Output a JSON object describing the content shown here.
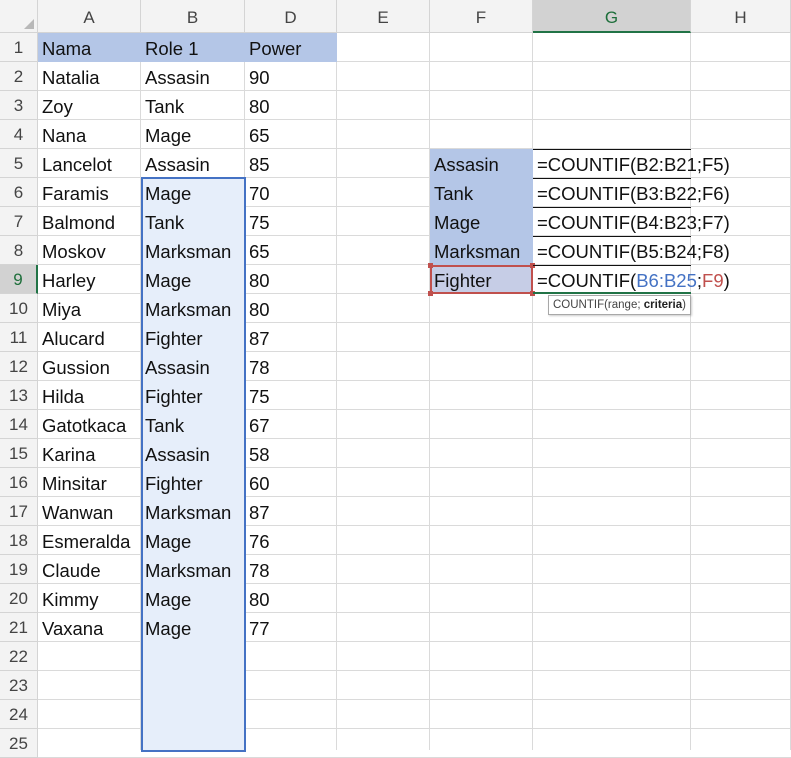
{
  "columns": [
    "A",
    "B",
    "D",
    "E",
    "F",
    "G",
    "H"
  ],
  "active_column": "G",
  "active_row": 9,
  "rows": [
    1,
    2,
    3,
    4,
    5,
    6,
    7,
    8,
    9,
    10,
    11,
    12,
    13,
    14,
    15,
    16,
    17,
    18,
    19,
    20,
    21,
    22,
    23,
    24,
    25
  ],
  "header_row": {
    "A": "Nama",
    "B": "Role 1",
    "D": "Power"
  },
  "table": [
    {
      "name": "Natalia",
      "role": "Assasin",
      "power": "90"
    },
    {
      "name": "Zoy",
      "role": "Tank",
      "power": "80"
    },
    {
      "name": "Nana",
      "role": "Mage",
      "power": "65"
    },
    {
      "name": "Lancelot",
      "role": "Assasin",
      "power": "85"
    },
    {
      "name": "Faramis",
      "role": "Mage",
      "power": "70"
    },
    {
      "name": "Balmond",
      "role": "Tank",
      "power": "75"
    },
    {
      "name": "Moskov",
      "role": "Marksman",
      "power": "65"
    },
    {
      "name": "Harley",
      "role": "Mage",
      "power": "80"
    },
    {
      "name": "Miya",
      "role": "Marksman",
      "power": "80"
    },
    {
      "name": "Alucard",
      "role": "Fighter",
      "power": "87"
    },
    {
      "name": "Gussion",
      "role": "Assasin",
      "power": "78"
    },
    {
      "name": "Hilda",
      "role": "Fighter",
      "power": "75"
    },
    {
      "name": "Gatotkaca",
      "role": "Tank",
      "power": "67"
    },
    {
      "name": "Karina",
      "role": "Assasin",
      "power": "58"
    },
    {
      "name": "Minsitar",
      "role": "Fighter",
      "power": "60"
    },
    {
      "name": "Wanwan",
      "role": "Marksman",
      "power": "87"
    },
    {
      "name": "Esmeralda",
      "role": "Mage",
      "power": "76"
    },
    {
      "name": "Claude",
      "role": "Marksman",
      "power": "78"
    },
    {
      "name": "Kimmy",
      "role": "Mage",
      "power": "80"
    },
    {
      "name": "Vaxana",
      "role": "Mage",
      "power": "77"
    }
  ],
  "summary": [
    {
      "role": "Assasin",
      "formula": "=COUNTIF(B2:B21;F5)"
    },
    {
      "role": "Tank",
      "formula": "=COUNTIF(B3:B22;F6)"
    },
    {
      "role": "Mage",
      "formula": "=COUNTIF(B4:B23;F7)"
    },
    {
      "role": "Marksman",
      "formula": "=COUNTIF(B5:B24;F8)"
    }
  ],
  "editing": {
    "role": "Fighter",
    "prefix": "=COUNTIF(",
    "range_ref": "B6:B25",
    "sep": ";",
    "crit_ref": "F9",
    "suffix": ")"
  },
  "tooltip": {
    "fn": "COUNTIF(range; ",
    "arg": "criteria",
    "close": ")"
  },
  "colors": {
    "header_fill": "#b4c6e7",
    "selection_border": "#4472c4",
    "criteria_red": "#c0504d",
    "active_green": "#217346"
  }
}
